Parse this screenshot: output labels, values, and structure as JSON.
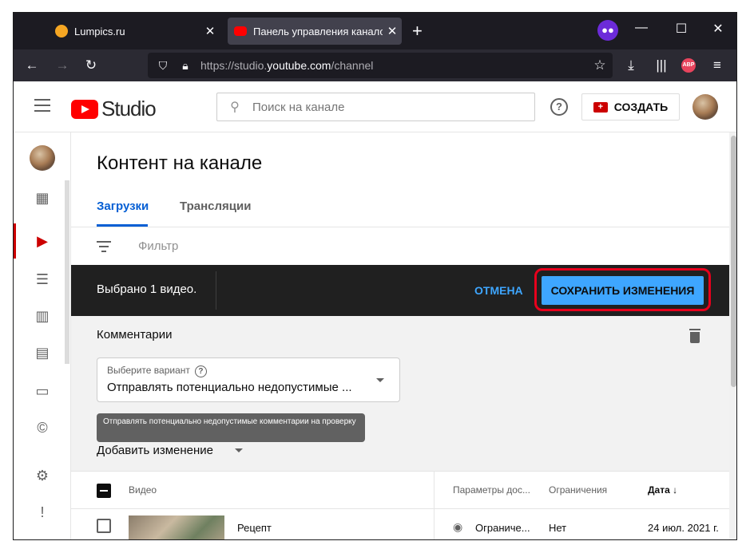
{
  "browser": {
    "tabs": [
      {
        "title": "Lumpics.ru",
        "favicon_color": "#f5a623"
      },
      {
        "title": "Панель управления каналом",
        "favicon_color": "#ff0000",
        "active": true
      }
    ],
    "new_tab": "+",
    "url": {
      "prefix": "https://studio.",
      "domain": "youtube.com",
      "path": "/channel"
    },
    "ext_abp": "ABP"
  },
  "header": {
    "logo_text": "Studio",
    "search_placeholder": "Поиск на канале",
    "help": "?",
    "create_label": "СОЗДАТЬ"
  },
  "page": {
    "title": "Контент на канале",
    "tabs": [
      {
        "label": "Загрузки",
        "active": true
      },
      {
        "label": "Трансляции"
      }
    ],
    "filter_placeholder": "Фильтр"
  },
  "selection_bar": {
    "selected_text": "Выбрано 1 видео.",
    "cancel_label": "ОТМЕНА",
    "save_label": "СОХРАНИТЬ ИЗМЕНЕНИЯ"
  },
  "edit_panel": {
    "section_label": "Комментарии",
    "select_label": "Выберите вариант",
    "select_value": "Отправлять потенциально недопустимые ...",
    "tooltip": "Отправлять потенциально недопустимые комментарии на проверку",
    "add_change_label": "Добавить изменение"
  },
  "table": {
    "headers": {
      "video": "Видео",
      "visibility": "Параметры дос...",
      "restrictions": "Ограничения",
      "date": "Дата"
    },
    "rows": [
      {
        "title": "Рецепт",
        "visibility": "Ограниче...",
        "restrictions": "Нет",
        "date": "24 июл. 2021 г."
      }
    ]
  },
  "colors": {
    "accent_blue": "#3ea6ff",
    "link_blue": "#065fd4",
    "highlight_red": "#e8001c",
    "yt_red": "#ff0000"
  }
}
